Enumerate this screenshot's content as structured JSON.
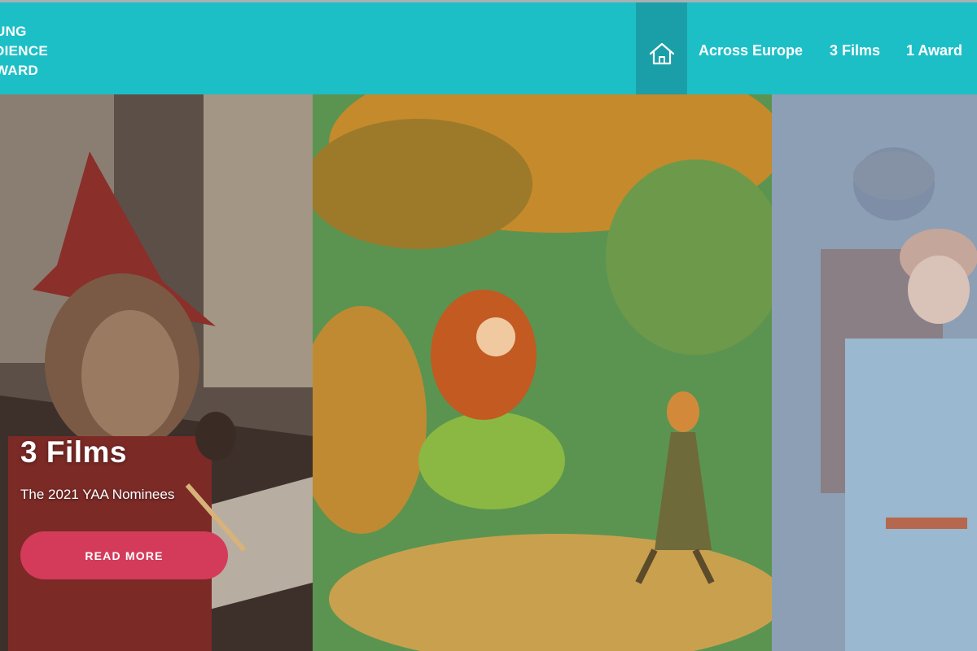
{
  "header": {
    "logo_lines": [
      "UNG",
      "DIENCE",
      "WARD"
    ],
    "nav": {
      "home_icon": "home-icon",
      "links": [
        "Across Europe",
        "3 Films",
        "1 Award"
      ]
    }
  },
  "hero": {
    "title": "3 Films",
    "subtitle": "The 2021 YAA Nominees",
    "button_label": "READ MORE"
  },
  "colors": {
    "header_bg": "#1dbfc7",
    "home_tab_bg": "#1a9fa8",
    "button_bg": "#d43b5a",
    "text": "#ffffff"
  }
}
